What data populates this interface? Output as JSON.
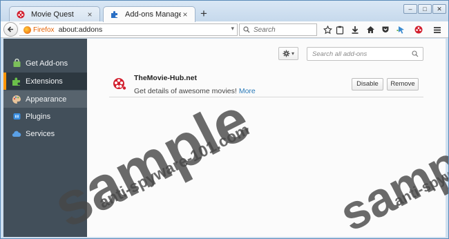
{
  "tabs": [
    {
      "title": "Movie Quest",
      "active": false,
      "icon": "movie-quest-favicon"
    },
    {
      "title": "Add-ons Manager",
      "active": true,
      "icon": "puzzle-piece-icon"
    }
  ],
  "new_tab_label": "+",
  "window_controls": {
    "minimize": "–",
    "maximize": "□",
    "close": "✕"
  },
  "urlbar": {
    "identity": "Firefox",
    "url": "about:addons"
  },
  "searchbar": {
    "placeholder": "Search"
  },
  "toolbar_icons": [
    "star-icon",
    "reading-list-icon",
    "download-icon",
    "home-icon",
    "pocket-icon",
    "pointer-icon",
    "addon-icon",
    "menu-icon"
  ],
  "sidebar": {
    "items": [
      {
        "label": "Get Add-ons",
        "icon": "shopping-bag-icon",
        "state": "normal"
      },
      {
        "label": "Extensions",
        "icon": "puzzle-piece-icon",
        "state": "selected"
      },
      {
        "label": "Appearance",
        "icon": "palette-icon",
        "state": "hover"
      },
      {
        "label": "Plugins",
        "icon": "plugin-icon",
        "state": "normal"
      },
      {
        "label": "Services",
        "icon": "cloud-icon",
        "state": "normal"
      }
    ]
  },
  "main": {
    "search_placeholder": "Search all add-ons",
    "addon": {
      "name": "TheMovie-Hub.net",
      "description": "Get details of awesome movies!",
      "more_label": "More",
      "disable_label": "Disable",
      "remove_label": "Remove"
    }
  },
  "watermark": {
    "big": "sample",
    "small": "anti-spyware-101.com"
  },
  "colors": {
    "accent": "#ff9500",
    "sidebar_bg": "#424f5a",
    "sidebar_selected": "#2d3840",
    "link": "#2a7ab8",
    "firefox_orange": "#e66000"
  }
}
